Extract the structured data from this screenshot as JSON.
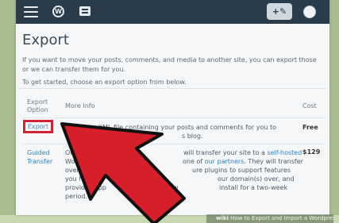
{
  "topbar": {
    "wp_logo": "W",
    "write_label": "+✎",
    "icons": [
      "menu-icon",
      "wordpress-logo-icon",
      "reader-icon",
      "write-icon",
      "avatar"
    ]
  },
  "page": {
    "title": "Export",
    "intro_line1": "If you want to move your posts, comments, and media to another site, you can export those",
    "intro_line2": "or we can transfer them for you.",
    "instruction": "To get started, choose an export option from below."
  },
  "table": {
    "headers": {
      "option_line1": "Export",
      "option_line2": "Option",
      "info": "More Info",
      "cost": "Cost"
    },
    "rows": [
      {
        "option": "Export",
        "info_line1": "Create an XML file containing your posts and comments for you to",
        "info_line2": "s blog.",
        "cost": "Free"
      },
      {
        "option_line1": "Guided",
        "option_line2": "Transfer",
        "info_a": "Or",
        "info_b": "will transfer your site to a",
        "info_hosted": "self-hosted",
        "info_c": "Word",
        "info_d": "one of",
        "info_partners": "our partners",
        "info_e": ". They will transfer",
        "info_f": "over all y",
        "info_g": "ure plugins to support features",
        "info_h": "you have u",
        "info_i": "our domain(s) over, and",
        "info_j": "provide supp",
        "info_k": "new",
        "info_l": "install for a two-week",
        "info_m": "period.",
        "cost": "$129"
      }
    ]
  },
  "watermark": {
    "brand": "wiki",
    "text": "How to Export and Import a Wordpress Bl"
  },
  "colors": {
    "topbar": "#2a3b4a",
    "link": "#2f80c6",
    "highlight_box": "#cf2536",
    "arrow": "#d71e2b"
  }
}
